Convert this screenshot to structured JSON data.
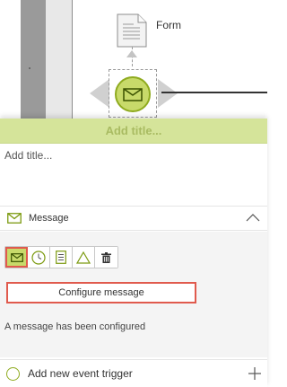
{
  "diagram": {
    "form_label": "Form",
    "form_icon": "document-icon",
    "event_icon": "envelope-icon",
    "event_color": "#c8da6a",
    "event_border_color": "#8fab1f"
  },
  "panel": {
    "title_placeholder": "Add title...",
    "title_field_placeholder": "Add title...",
    "section_title": "Message",
    "section_icon": "envelope-icon",
    "type_buttons": [
      {
        "name": "message",
        "icon": "envelope-icon",
        "active": true
      },
      {
        "name": "timer",
        "icon": "clock-icon",
        "active": false
      },
      {
        "name": "conditional",
        "icon": "document-icon",
        "active": false
      },
      {
        "name": "signal",
        "icon": "triangle-icon",
        "active": false
      },
      {
        "name": "delete",
        "icon": "trash-icon",
        "active": false
      }
    ],
    "configure_label": "Configure message",
    "config_status": "A message has been configured",
    "footer_label": "Add new event trigger",
    "accent_color": "#d5e49a",
    "highlight_color": "#e05a4d"
  }
}
